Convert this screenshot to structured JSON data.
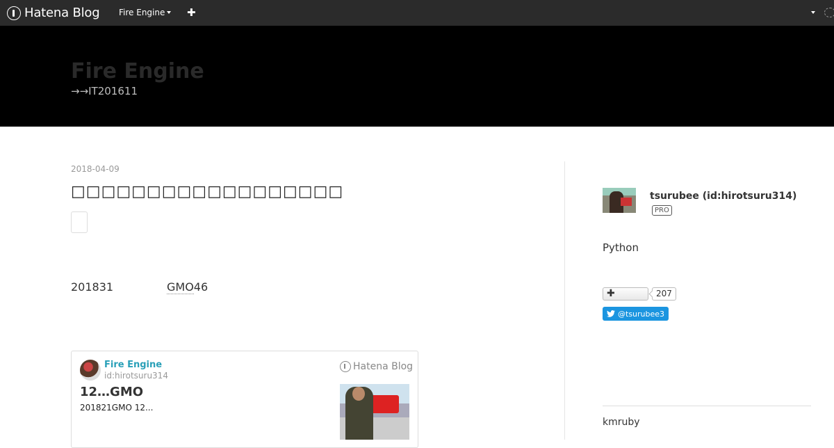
{
  "global_header": {
    "brand": "Hatena Blog",
    "blog_menu_label": "Fire Engine",
    "add_label": "✚"
  },
  "blog": {
    "title": "Fire Engine",
    "description": "→→IT201611"
  },
  "entry": {
    "date": "2018-04-09",
    "title": "□□□□□□□□□□□□□□□□□□",
    "text_left": "201831",
    "keyword": "GMO",
    "keyword_suffix": "46"
  },
  "embed": {
    "blog_name": "Fire Engine",
    "author_id": "id:hirotsuru314",
    "logo_text": "Hatena Blog",
    "title": "12…GMO",
    "summary": "201821GMO 12..."
  },
  "sidebar": {
    "profile_name": "tsurubee (id:hirotsuru314)",
    "pro_badge": "PRO",
    "description": "Python",
    "subscriber_count": "207",
    "twitter_handle": "@tsurubee3",
    "section_title": "kmruby"
  },
  "colors": {
    "header_bg": "#2b2b2b",
    "title_bg": "#000000",
    "link_accent": "#2aa0b8",
    "twitter_blue": "#1b95e0"
  }
}
